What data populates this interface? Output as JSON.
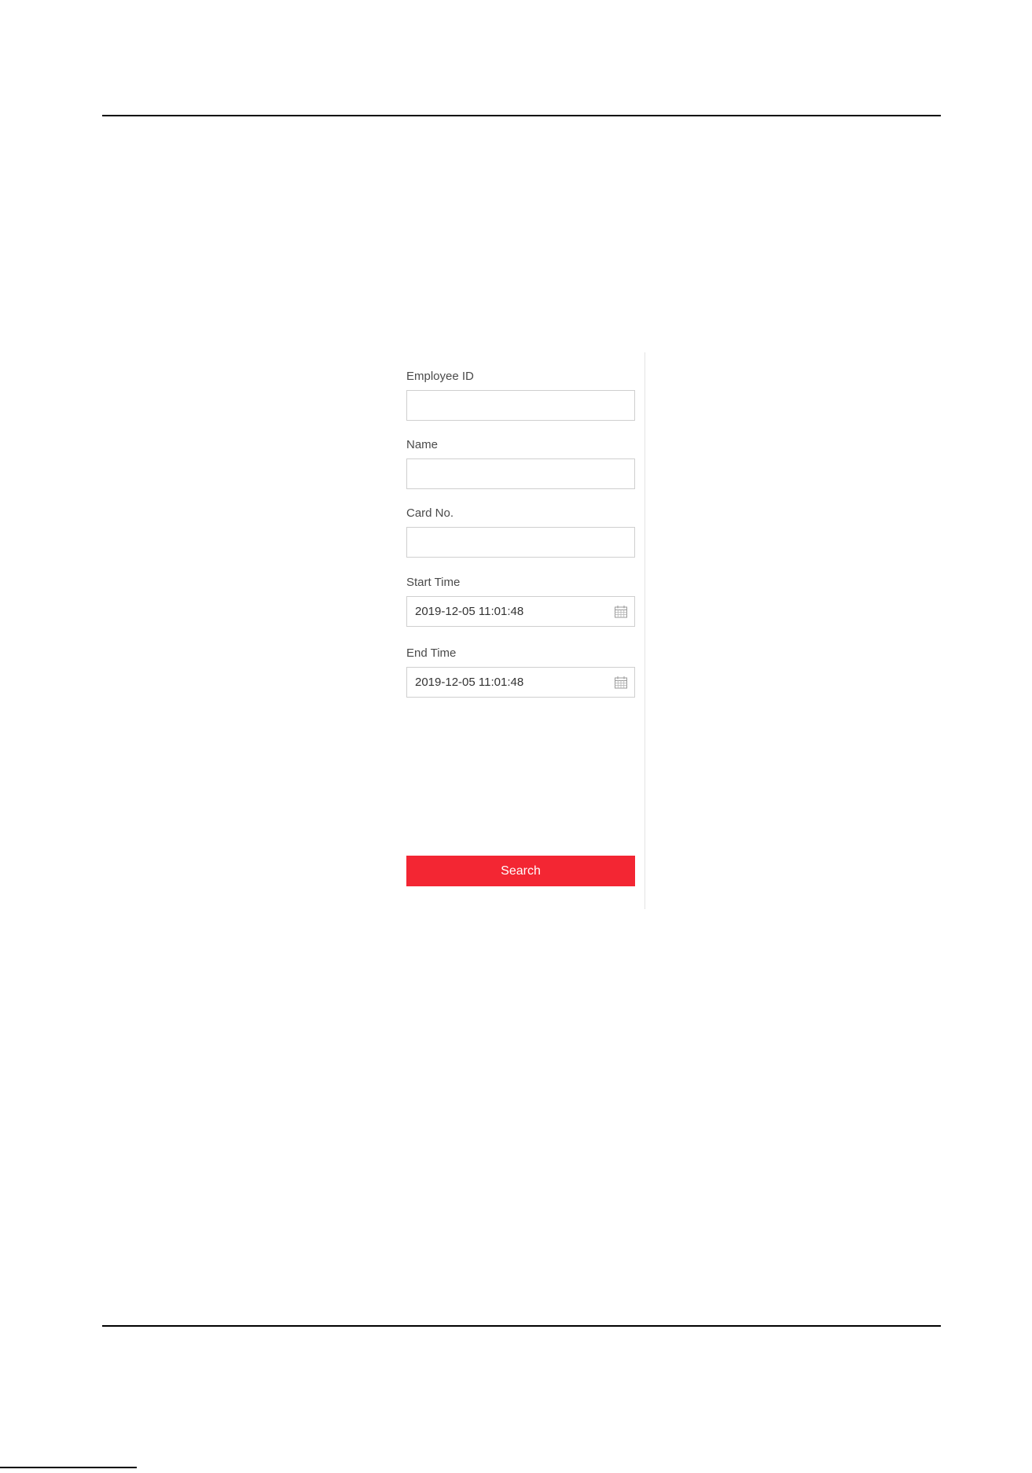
{
  "form": {
    "employee_id": {
      "label": "Employee ID",
      "value": ""
    },
    "name": {
      "label": "Name",
      "value": ""
    },
    "card_no": {
      "label": "Card No.",
      "value": ""
    },
    "start_time": {
      "label": "Start Time",
      "value": "2019-12-05 11:01:48",
      "icon": "calendar-icon"
    },
    "end_time": {
      "label": "End Time",
      "value": "2019-12-05 11:01:48",
      "icon": "calendar-icon"
    },
    "search_label": "Search"
  },
  "colors": {
    "accent": "#f32633",
    "rule": "#000000",
    "input_border": "#cfcfcf",
    "divider": "#e3e3e3"
  }
}
